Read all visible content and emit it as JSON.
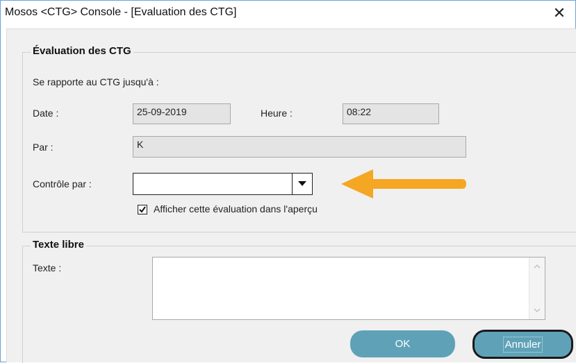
{
  "window": {
    "title": "Mosos <CTG> Console - [Evaluation des CTG]",
    "close_label": "✕"
  },
  "evaluation": {
    "group_title": "Évaluation des CTG",
    "subtitle": "Se rapporte au CTG jusqu'à :",
    "date_label": "Date :",
    "date_value": "25-09-2019",
    "time_label": "Heure :",
    "time_value": "08:22",
    "by_label": "Par :",
    "by_value": "K",
    "controlled_label": "Contrôle par :",
    "controlled_value": "",
    "checkbox_label": "Afficher cette évaluation dans l'aperçu",
    "checkbox_checked": true
  },
  "free_text": {
    "group_title": "Texte libre",
    "text_label": "Texte :",
    "text_value": ""
  },
  "buttons": {
    "ok": "OK",
    "cancel": "Annuler"
  },
  "annotation": {
    "arrow_color": "#f5a623"
  }
}
